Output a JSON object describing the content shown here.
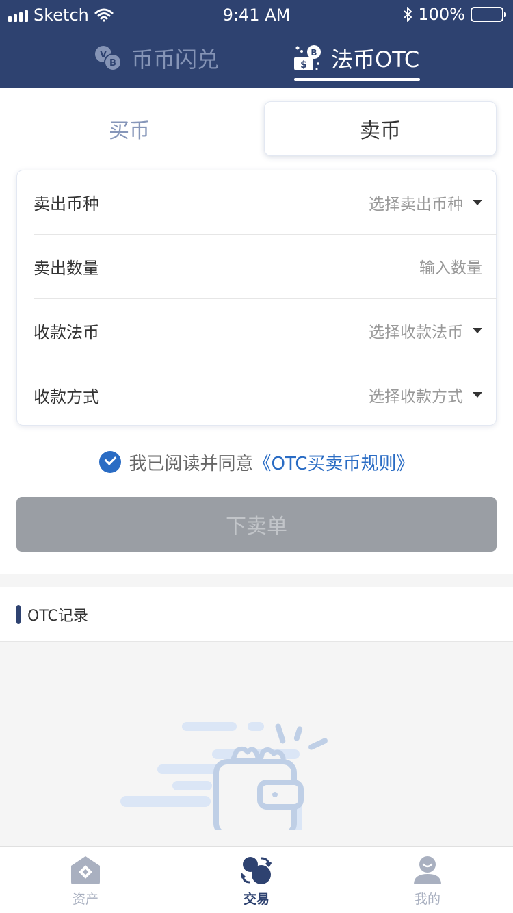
{
  "status_bar": {
    "carrier": "Sketch",
    "time": "9:41 AM",
    "battery": "100%"
  },
  "top_tabs": [
    {
      "label": "币币闪兑",
      "icon": "coin-swap-icon",
      "active": false
    },
    {
      "label": "法币OTC",
      "icon": "cash-otc-icon",
      "active": true
    }
  ],
  "trade_switch": {
    "buy_label": "买币",
    "sell_label": "卖币",
    "active": "sell"
  },
  "form": {
    "rows": [
      {
        "label": "卖出币种",
        "value": "选择卖出币种",
        "dropdown": true
      },
      {
        "label": "卖出数量",
        "value": "输入数量",
        "dropdown": false
      },
      {
        "label": "收款法币",
        "value": "选择收款法币",
        "dropdown": true
      },
      {
        "label": "收款方式",
        "value": "选择收款方式",
        "dropdown": true
      }
    ]
  },
  "agreement": {
    "text": "我已阅读并同意",
    "link": "《OTC买卖币规则》",
    "checked": true
  },
  "submit_label": "下卖单",
  "records": {
    "title": "OTC记录",
    "empty_icon": "empty-wallet-icon"
  },
  "bottom_nav": [
    {
      "label": "资产",
      "icon": "assets-icon",
      "active": false
    },
    {
      "label": "交易",
      "icon": "trade-icon",
      "active": true
    },
    {
      "label": "我的",
      "icon": "profile-icon",
      "active": false
    }
  ],
  "colors": {
    "header_bg": "#2e4270",
    "accent_blue": "#2a6cc4",
    "button_disabled": "#9a9ea4"
  }
}
